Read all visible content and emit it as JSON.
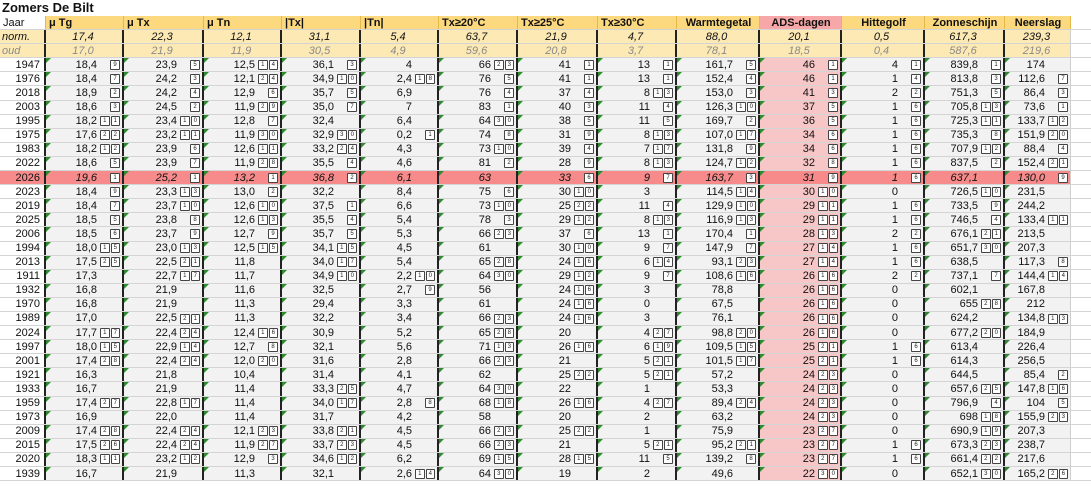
{
  "title": "Zomers De Bilt",
  "headers": [
    "Jaar",
    "μ Tg",
    "μ Tx",
    "μ Tn",
    "|Tx|",
    "|Tn|",
    "Tx≥20°C",
    "Tx≥25°C",
    "Tx≥30°C",
    "Warmtegetal",
    "ADS-dagen",
    "Hittegolf",
    "Zonneschijn",
    "Neerslag"
  ],
  "norm": [
    "norm.",
    "17,4",
    "22,3",
    "12,1",
    "31,1",
    "5,4",
    "63,7",
    "21,9",
    "4,7",
    "88,0",
    "20,1",
    "0,5",
    "617,3",
    "239,3"
  ],
  "oud": [
    "oud",
    "17,0",
    "21,9",
    "11,9",
    "30,5",
    "4,9",
    "59,6",
    "20,8",
    "3,7",
    "78,1",
    "18,5",
    "0,4",
    "587,6",
    "219,6"
  ],
  "highlight_year": "2026",
  "rows": [
    [
      "1947",
      "18,4",
      "9",
      "23,9",
      "5",
      "12,5",
      "14",
      "36,1",
      "3",
      "4",
      "",
      "66",
      "23",
      "41",
      "1",
      "13",
      "1",
      "161,7",
      "5",
      "46",
      "1",
      "4",
      "1",
      "839,8",
      "1",
      "174",
      ""
    ],
    [
      "1976",
      "18,4",
      "7",
      "24,2",
      "3",
      "12,1",
      "24",
      "34,9",
      "10",
      "2,4",
      "18",
      "76",
      "5",
      "41",
      "1",
      "13",
      "1",
      "152,4",
      "4",
      "46",
      "1",
      "1",
      "4",
      "813,8",
      "3",
      "112,6",
      "7"
    ],
    [
      "2018",
      "18,9",
      "2",
      "24,2",
      "4",
      "12,9",
      "6",
      "35,7",
      "5",
      "6,9",
      "",
      "76",
      "4",
      "37",
      "4",
      "8",
      "13",
      "153,0",
      "3",
      "41",
      "3",
      "2",
      "2",
      "751,3",
      "5",
      "86,4",
      "3"
    ],
    [
      "2003",
      "18,6",
      "3",
      "24,5",
      "2",
      "11,9",
      "29",
      "35,0",
      "7",
      "7",
      "",
      "83",
      "1",
      "40",
      "3",
      "11",
      "4",
      "126,3",
      "10",
      "37",
      "5",
      "1",
      "6",
      "705,8",
      "13",
      "73,6",
      "1"
    ],
    [
      "1995",
      "18,2",
      "11",
      "23,4",
      "10",
      "12,8",
      "7",
      "32,4",
      "",
      "6,4",
      "",
      "64",
      "30",
      "38",
      "5",
      "11",
      "5",
      "169,7",
      "2",
      "36",
      "5",
      "1",
      "6",
      "725,3",
      "11",
      "133,7",
      "12"
    ],
    [
      "1975",
      "17,6",
      "22",
      "23,2",
      "11",
      "11,9",
      "30",
      "32,9",
      "30",
      "0,2",
      "1",
      "74",
      "8",
      "31",
      "9",
      "8",
      "13",
      "107,0",
      "17",
      "34",
      "6",
      "1",
      "6",
      "735,3",
      "8",
      "151,9",
      "20"
    ],
    [
      "1983",
      "18,2",
      "12",
      "23,9",
      "6",
      "12,6",
      "11",
      "33,2",
      "24",
      "4,3",
      "",
      "73",
      "10",
      "39",
      "4",
      "7",
      "17",
      "131,8",
      "9",
      "34",
      "6",
      "1",
      "6",
      "707,9",
      "12",
      "88,4",
      "4"
    ],
    [
      "2022",
      "18,6",
      "5",
      "23,9",
      "7",
      "11,9",
      "28",
      "35,5",
      "4",
      "4,6",
      "",
      "81",
      "2",
      "28",
      "9",
      "8",
      "13",
      "124,7",
      "12",
      "32",
      "8",
      "1",
      "6",
      "837,5",
      "2",
      "152,4",
      "21"
    ],
    [
      "2026",
      "19,6",
      "1",
      "25,2",
      "1",
      "13,2",
      "1",
      "36,8",
      "2",
      "6,1",
      "",
      "63",
      "",
      "33",
      "6",
      "9",
      "7",
      "163,7",
      "3",
      "31",
      "9",
      "1",
      "6",
      "637,1",
      "",
      "130,0",
      "9"
    ],
    [
      "2023",
      "18,4",
      "9",
      "23,3",
      "13",
      "13,0",
      "2",
      "32,2",
      "",
      "8,4",
      "",
      "75",
      "6",
      "30",
      "10",
      "3",
      "",
      "114,5",
      "14",
      "30",
      "10",
      "0",
      "",
      "726,5",
      "10",
      "231,5",
      ""
    ],
    [
      "2019",
      "18,4",
      "7",
      "23,7",
      "10",
      "12,6",
      "10",
      "37,5",
      "1",
      "6,6",
      "",
      "73",
      "10",
      "25",
      "22",
      "11",
      "4",
      "129,9",
      "10",
      "29",
      "11",
      "1",
      "6",
      "733,5",
      "9",
      "244,2",
      ""
    ],
    [
      "2025",
      "18,5",
      "5",
      "23,8",
      "8",
      "12,6",
      "13",
      "35,5",
      "4",
      "5,4",
      "",
      "78",
      "3",
      "29",
      "12",
      "8",
      "13",
      "116,9",
      "13",
      "29",
      "11",
      "1",
      "6",
      "746,5",
      "4",
      "133,4",
      "11"
    ],
    [
      "2006",
      "18,5",
      "6",
      "23,7",
      "9",
      "12,7",
      "9",
      "35,7",
      "5",
      "5,3",
      "",
      "66",
      "23",
      "37",
      "6",
      "13",
      "1",
      "170,4",
      "1",
      "28",
      "13",
      "2",
      "2",
      "676,1",
      "21",
      "213,5",
      ""
    ],
    [
      "1994",
      "18,0",
      "15",
      "23,0",
      "13",
      "12,5",
      "15",
      "34,1",
      "15",
      "4,5",
      "",
      "61",
      "",
      "30",
      "10",
      "9",
      "7",
      "147,9",
      "7",
      "27",
      "14",
      "1",
      "6",
      "651,7",
      "30",
      "207,3",
      ""
    ],
    [
      "2013",
      "17,5",
      "25",
      "22,5",
      "21",
      "11,8",
      "",
      "34,0",
      "17",
      "5,4",
      "",
      "65",
      "28",
      "24",
      "16",
      "6",
      "14",
      "93,1",
      "23",
      "27",
      "14",
      "1",
      "6",
      "638,5",
      "",
      "117,3",
      "8"
    ],
    [
      "1911",
      "17,3",
      "",
      "22,7",
      "17",
      "11,7",
      "",
      "34,9",
      "10",
      "2,2",
      "10",
      "64",
      "30",
      "29",
      "12",
      "9",
      "7",
      "108,6",
      "16",
      "26",
      "16",
      "2",
      "2",
      "737,1",
      "7",
      "144,4",
      "14"
    ],
    [
      "1932",
      "16,8",
      "",
      "21,9",
      "",
      "11,6",
      "",
      "32,5",
      "",
      "2,7",
      "9",
      "56",
      "",
      "24",
      "16",
      "3",
      "",
      "78,8",
      "",
      "26",
      "16",
      "0",
      "",
      "602,1",
      "",
      "167,8",
      ""
    ],
    [
      "1970",
      "16,8",
      "",
      "21,9",
      "",
      "11,3",
      "",
      "29,4",
      "",
      "3,3",
      "",
      "61",
      "",
      "24",
      "16",
      "0",
      "",
      "67,5",
      "",
      "26",
      "16",
      "0",
      "",
      "655",
      "28",
      "212",
      ""
    ],
    [
      "1989",
      "17,0",
      "",
      "22,5",
      "21",
      "11,3",
      "",
      "32,2",
      "",
      "3,4",
      "",
      "66",
      "23",
      "24",
      "16",
      "3",
      "",
      "76,1",
      "",
      "26",
      "16",
      "0",
      "",
      "624,2",
      "",
      "134,8",
      "13"
    ],
    [
      "2024",
      "17,7",
      "17",
      "22,4",
      "24",
      "12,4",
      "16",
      "30,9",
      "",
      "5,2",
      "",
      "65",
      "28",
      "20",
      "",
      "4",
      "27",
      "98,8",
      "20",
      "26",
      "16",
      "0",
      "",
      "677,2",
      "20",
      "184,9",
      ""
    ],
    [
      "1997",
      "18,0",
      "15",
      "22,9",
      "14",
      "12,7",
      "8",
      "32,1",
      "",
      "5,6",
      "",
      "71",
      "13",
      "26",
      "16",
      "6",
      "19",
      "109,5",
      "15",
      "25",
      "21",
      "1",
      "6",
      "613,4",
      "",
      "226,4",
      ""
    ],
    [
      "2001",
      "17,4",
      "28",
      "22,4",
      "24",
      "12,0",
      "20",
      "31,6",
      "",
      "2,8",
      "",
      "66",
      "23",
      "21",
      "",
      "5",
      "21",
      "101,5",
      "17",
      "25",
      "21",
      "1",
      "6",
      "614,3",
      "",
      "256,5",
      ""
    ],
    [
      "1921",
      "16,3",
      "",
      "21,8",
      "",
      "10,4",
      "",
      "31,4",
      "",
      "4,1",
      "",
      "62",
      "",
      "25",
      "22",
      "5",
      "21",
      "57,2",
      "",
      "24",
      "23",
      "0",
      "",
      "644,5",
      "",
      "85,4",
      "2"
    ],
    [
      "1933",
      "16,7",
      "",
      "21,9",
      "",
      "11,4",
      "",
      "33,3",
      "25",
      "4,7",
      "",
      "64",
      "30",
      "22",
      "",
      "1",
      "",
      "53,3",
      "",
      "24",
      "23",
      "0",
      "",
      "657,6",
      "25",
      "147,8",
      "16"
    ],
    [
      "1959",
      "17,4",
      "27",
      "22,8",
      "17",
      "11,4",
      "",
      "34,0",
      "17",
      "2,8",
      "8",
      "68",
      "18",
      "26",
      "16",
      "4",
      "27",
      "89,4",
      "24",
      "24",
      "23",
      "0",
      "",
      "796,9",
      "4",
      "104",
      "5"
    ],
    [
      "1973",
      "16,9",
      "",
      "22,0",
      "",
      "11,4",
      "",
      "31,7",
      "",
      "4,2",
      "",
      "58",
      "",
      "20",
      "",
      "2",
      "",
      "63,2",
      "",
      "24",
      "23",
      "0",
      "",
      "698",
      "18",
      "155,9",
      "23"
    ],
    [
      "2009",
      "17,4",
      "28",
      "22,4",
      "24",
      "12,1",
      "23",
      "33,8",
      "21",
      "4,5",
      "",
      "66",
      "23",
      "25",
      "22",
      "1",
      "",
      "75,9",
      "",
      "23",
      "27",
      "0",
      "",
      "690,9",
      "19",
      "207,3",
      ""
    ],
    [
      "2015",
      "17,5",
      "26",
      "22,4",
      "24",
      "11,9",
      "27",
      "33,7",
      "23",
      "4,5",
      "",
      "66",
      "23",
      "21",
      "",
      "5",
      "21",
      "95,2",
      "21",
      "23",
      "27",
      "1",
      "6",
      "673,3",
      "23",
      "238,7",
      ""
    ],
    [
      "2020",
      "18,3",
      "11",
      "23,2",
      "12",
      "12,9",
      "3",
      "34,6",
      "12",
      "6,2",
      "",
      "69",
      "15",
      "28",
      "15",
      "11",
      "5",
      "139,2",
      "8",
      "23",
      "27",
      "1",
      "6",
      "661,4",
      "22",
      "217,6",
      ""
    ],
    [
      "1939",
      "16,7",
      "",
      "21,9",
      "",
      "11,3",
      "",
      "32,1",
      "",
      "2,6",
      "14",
      "64",
      "30",
      "19",
      "",
      "2",
      "",
      "49,6",
      "",
      "22",
      "30",
      "0",
      "",
      "652,1",
      "30",
      "165,2",
      "26"
    ]
  ]
}
